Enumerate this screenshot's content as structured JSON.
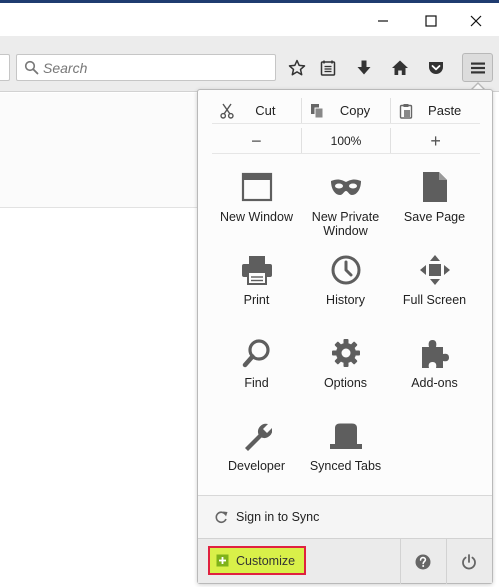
{
  "window": {
    "controls": [
      "minimize-icon",
      "maximize-icon",
      "close-icon"
    ]
  },
  "toolbar": {
    "search": {
      "placeholder": "Search",
      "value": ""
    },
    "icons": [
      "bookmark-star-icon",
      "reading-list-icon",
      "downloads-icon",
      "home-icon",
      "pocket-icon",
      "hamburger-menu-icon"
    ]
  },
  "menu": {
    "edit": {
      "cut": "Cut",
      "copy": "Copy",
      "paste": "Paste"
    },
    "zoom": {
      "out": "−",
      "level": "100%",
      "in": "+"
    },
    "items": {
      "new_window": "New Window",
      "private_window": "New Private Window",
      "save_page": "Save Page",
      "print": "Print",
      "history": "History",
      "full_screen": "Full Screen",
      "find": "Find",
      "options": "Options",
      "addons": "Add-ons",
      "developer": "Developer",
      "synced_tabs": "Synced Tabs"
    },
    "sync": "Sign in to Sync",
    "customize": "Customize"
  },
  "colors": {
    "icon": "#5e5e5e",
    "customize_highlight": "#d9f049",
    "customize_outline": "#e0213f"
  }
}
